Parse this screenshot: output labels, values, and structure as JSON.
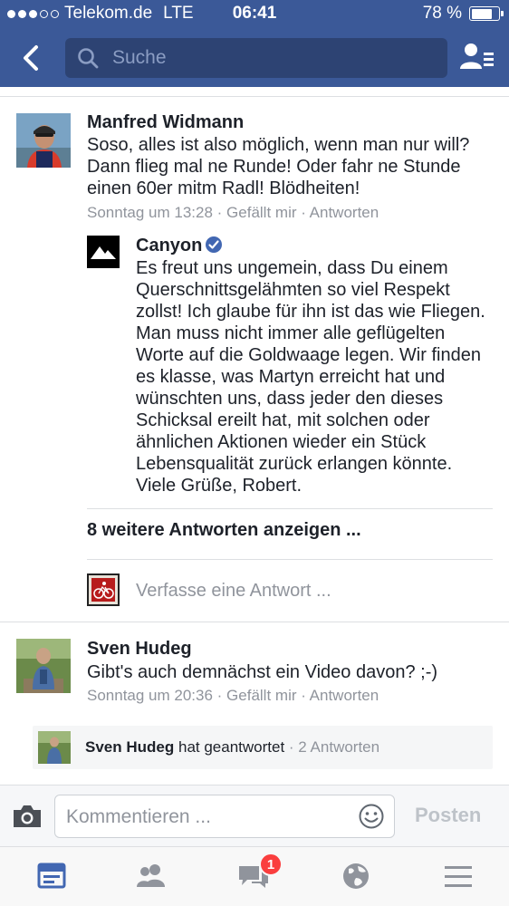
{
  "status_bar": {
    "carrier": "Telekom.de",
    "network": "LTE",
    "time": "06:41",
    "battery_percent": "78 %",
    "battery_level": 0.78
  },
  "header": {
    "back_icon": "chevron-left-icon",
    "search_placeholder": "Suche",
    "friends_icon": "friend-list-icon"
  },
  "comments": [
    {
      "author": "Manfred Widmann",
      "text": "Soso, alles ist also möglich, wenn man nur will? Dann flieg mal ne Runde! Oder fahr ne Stunde einen 60er mitm Radl! Blödheiten!",
      "meta": "Sonntag um 13:28 · Gefällt mir · Antworten",
      "reply": {
        "author": "Canyon",
        "verified": true,
        "text": "Es freut uns ungemein, dass Du einem Querschnittsgelähmten so viel Respekt zollst! Ich glaube für ihn ist das wie Fliegen. Man muss nicht immer alle geflügelten Worte auf die Goldwaage legen. Wir finden es klasse, was Martyn erreicht hat und wünschten uns, dass jeder den dieses Schicksal ereilt hat, mit solchen oder ähnlichen Aktionen wieder ein Stück Lebensqualität zurück erlangen könnte. Viele Grüße, Robert."
      },
      "more_replies": "8 weitere Antworten anzeigen ...",
      "reply_placeholder": "Verfasse eine Antwort ..."
    },
    {
      "author": "Sven Hudeg",
      "text": "Gibt's auch demnächst ein Video davon?  ;-)",
      "meta": "Sonntag um 20:36 · Gefällt mir · Antworten",
      "replied": {
        "author": "Sven Hudeg",
        "action": "hat geantwortet",
        "count": "· 2 Antworten"
      }
    }
  ],
  "composer": {
    "placeholder": "Kommentieren ...",
    "post_label": "Posten",
    "camera_icon": "camera-icon",
    "emoji_icon": "emoji-icon"
  },
  "tabbar": {
    "tabs": [
      "news-feed-icon",
      "friends-icon",
      "messages-icon",
      "globe-icon",
      "menu-icon"
    ],
    "messages_badge": "1"
  },
  "colors": {
    "brand": "#3b5998",
    "badge": "#fa3e3e",
    "verified": "#4267b2",
    "active_tab": "#4267b2"
  }
}
